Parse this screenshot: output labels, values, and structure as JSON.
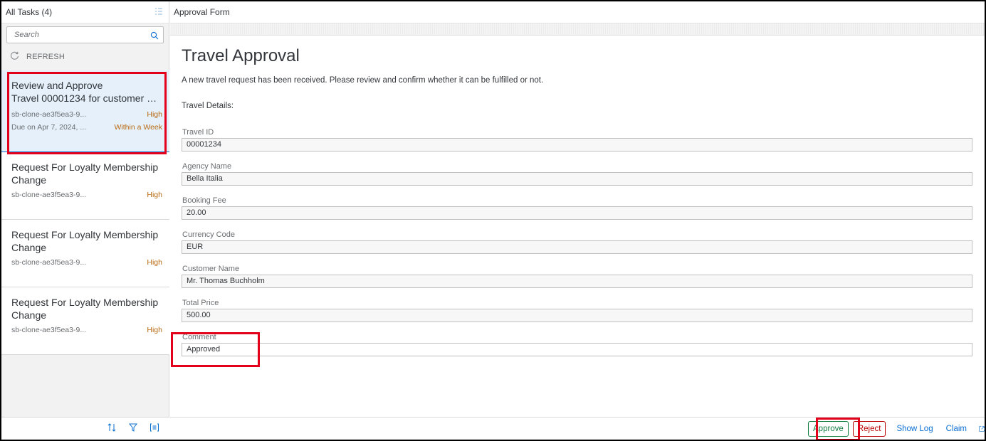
{
  "left_pane": {
    "header_title": "All Tasks (4)",
    "header_icon": "list-settings-icon",
    "search_placeholder": "Search",
    "refresh_label": "REFRESH",
    "tasks": [
      {
        "title_line1": "Review and Approve",
        "title_line2": "Travel 00001234 for customer Mr....",
        "origin": "sb-clone-ae3f5ea3-9...",
        "priority": "High",
        "due": "Due on Apr 7, 2024, ...",
        "due_status": "Within a Week"
      },
      {
        "title_line1": "Request For Loyalty Membership",
        "title_line2": "Change",
        "origin": "sb-clone-ae3f5ea3-9...",
        "priority": "High"
      },
      {
        "title_line1": "Request For Loyalty Membership",
        "title_line2": "Change",
        "origin": "sb-clone-ae3f5ea3-9...",
        "priority": "High"
      },
      {
        "title_line1": "Request For Loyalty Membership",
        "title_line2": "Change",
        "origin": "sb-clone-ae3f5ea3-9...",
        "priority": "High"
      }
    ],
    "footer_icons": [
      "sort-icon",
      "filter-icon",
      "group-icon"
    ]
  },
  "right_pane": {
    "header_title": "Approval Form",
    "form_title": "Travel Approval",
    "description": "A new travel request has been received. Please review and confirm whether it can be fulfilled or not.",
    "section_title": "Travel Details:",
    "fields": [
      {
        "label": "Travel ID",
        "value": "00001234"
      },
      {
        "label": "Agency Name",
        "value": "Bella Italia"
      },
      {
        "label": "Booking Fee",
        "value": "20.00"
      },
      {
        "label": "Currency Code",
        "value": "EUR"
      },
      {
        "label": "Customer Name",
        "value": "Mr. Thomas Buchholm"
      },
      {
        "label": "Total Price",
        "value": "500.00"
      },
      {
        "label": "Comment",
        "value": "Approved"
      }
    ],
    "footer": {
      "approve": "Approve",
      "reject": "Reject",
      "show_log": "Show Log",
      "claim": "Claim"
    }
  },
  "colors": {
    "brand_blue": "#0a6ed1",
    "priority_orange": "#b86a12",
    "approve_green": "#107e3e",
    "reject_red": "#bb0000",
    "annotation_red": "#e3001b",
    "selected_bg": "#e5f0fa"
  }
}
